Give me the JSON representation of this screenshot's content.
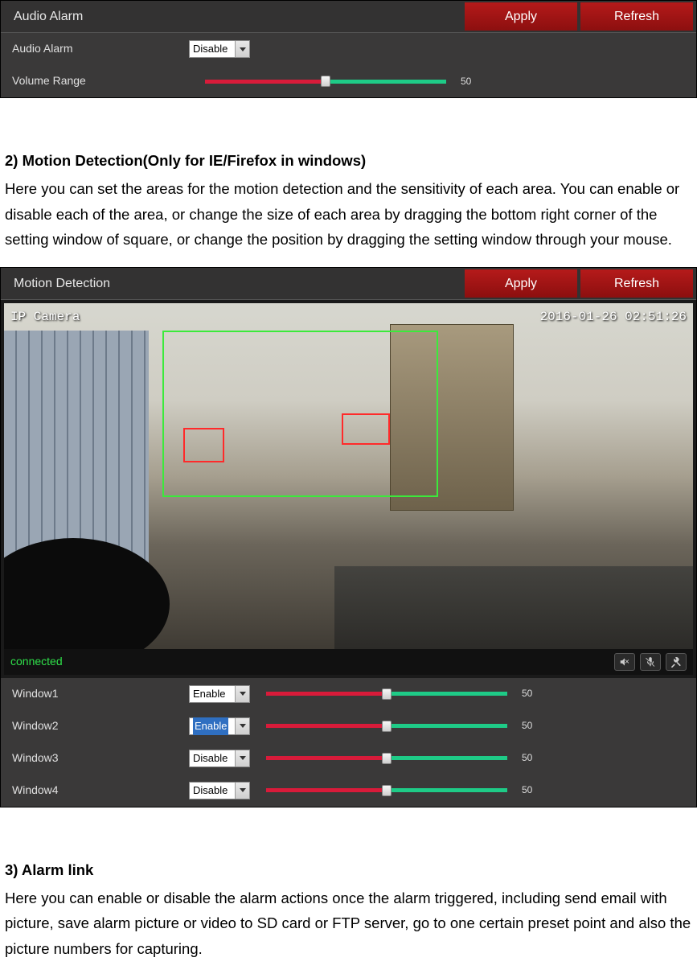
{
  "audio_panel": {
    "title": "Audio Alarm",
    "apply": "Apply",
    "refresh": "Refresh",
    "rows": {
      "alarm_label": "Audio Alarm",
      "alarm_value": "Disable",
      "volume_label": "Volume Range",
      "volume_value": "50"
    }
  },
  "section2": {
    "heading": "2) Motion Detection(Only for IE/Firefox in windows)",
    "paragraph": "Here you can set the areas for the motion detection and the sensitivity of each area. You can enable or disable each of the area, or change the size of each area by dragging the bottom right corner of the setting window of square, or change the position by dragging the setting window through your mouse."
  },
  "motion_panel": {
    "title": "Motion Detection",
    "apply": "Apply",
    "refresh": "Refresh",
    "overlay": {
      "camera_name": "IP Camera",
      "timestamp": "2016-01-26 02:51:26"
    },
    "status": "connected",
    "windows": [
      {
        "label": "Window1",
        "value": "Enable",
        "slider": "50",
        "highlight": false
      },
      {
        "label": "Window2",
        "value": "Enable",
        "slider": "50",
        "highlight": true
      },
      {
        "label": "Window3",
        "value": "Disable",
        "slider": "50",
        "highlight": false
      },
      {
        "label": "Window4",
        "value": "Disable",
        "slider": "50",
        "highlight": false
      }
    ]
  },
  "section3": {
    "heading": "3) Alarm link",
    "paragraph": "Here you can enable or disable the alarm actions once the alarm triggered, including send email with picture, save alarm picture or video to SD card or FTP server, go to one certain preset point and also the picture numbers for capturing."
  }
}
